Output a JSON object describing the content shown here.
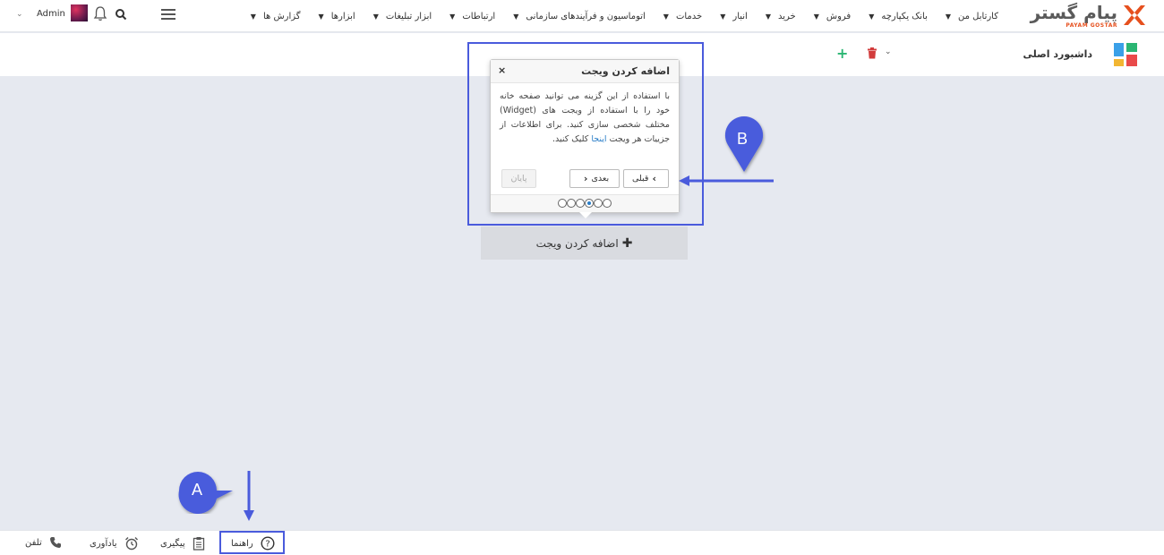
{
  "header": {
    "logo_text": "پیام گستر",
    "logo_sub": "PAYAM GOSTAR",
    "menu": [
      {
        "label": "کارتابل من"
      },
      {
        "label": "بانک یکپارچه"
      },
      {
        "label": "فروش"
      },
      {
        "label": "خرید"
      },
      {
        "label": "انبار"
      },
      {
        "label": "خدمات"
      },
      {
        "label": "اتوماسیون و فرآیندهای سازمانی"
      },
      {
        "label": "ارتباطات"
      },
      {
        "label": "ابزار تبلیغات"
      },
      {
        "label": "ابزارها"
      },
      {
        "label": "گزارش ها"
      }
    ],
    "user": "Admin",
    "icons": [
      "hamburger-icon",
      "search-icon",
      "bell-icon",
      "chevron-down-icon"
    ]
  },
  "dashboard": {
    "title": "داشبورد اصلی",
    "add_widget_label": "اضافه کردن ویجت",
    "icon_colors": [
      "#3aa0e8",
      "#f2b632",
      "#e94a4a",
      "#2bb673"
    ]
  },
  "tour": {
    "title": "اضافه کردن ویجت",
    "body_before_link": "با استفاده از این گزینه می توانید صفحه خانه خود را با استفاده از ویجت های (Widget) مختلف شخصی سازی کنید. برای اطلاعات از جزییات هر ویجت ",
    "link": "اینجا",
    "body_after_link": " کلیک کنید.",
    "prev_label": "قبلی",
    "next_label": "بعدی",
    "end_label": "پایان",
    "steps_total": 6,
    "active_step": 3
  },
  "annotations": {
    "a": "A",
    "b": "B",
    "color": "#4a5bdc"
  },
  "bottombar": {
    "items": [
      {
        "label": "تلفن",
        "icon": "phone-icon"
      },
      {
        "label": "یادآوری",
        "icon": "alarm-clock-icon"
      },
      {
        "label": "پیگیری",
        "icon": "clipboard-icon"
      },
      {
        "label": "راهنما",
        "icon": "help-circle-icon"
      }
    ]
  }
}
